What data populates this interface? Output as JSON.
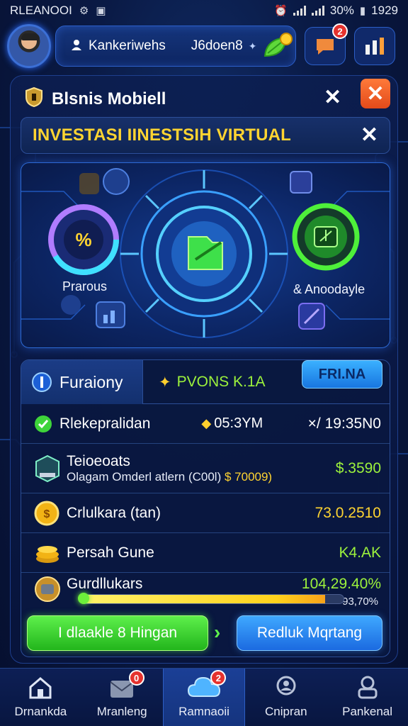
{
  "status_bar": {
    "carrier": "RLEANOOI",
    "battery": "30%",
    "time": "1929"
  },
  "header": {
    "username": "Kankeriwehs",
    "coins": "J6doen8",
    "notification_count": "2"
  },
  "panel": {
    "title": "Blsnis Mobiell",
    "banner": "INVESTASI IINESTSIH VIRTUAL",
    "hero": {
      "left_label": "Prarous",
      "right_label": "& Anoodayle"
    }
  },
  "stats": {
    "tabs": {
      "active": "Furaiony",
      "second": "PVONS K.1A",
      "button": "FRI.NA"
    },
    "rows": [
      {
        "label": "Rlekepralidan",
        "value_a": "05:3YM",
        "value_b": "×/ 19:35N0"
      },
      {
        "label": "Teioeoats",
        "sub": "Olagam Omderl atlern (C00l)",
        "sub_value": "$ 70009)",
        "value": "$.3590"
      },
      {
        "label": "Crlulkara (tan)",
        "value": "73.0.2510"
      },
      {
        "label": "Persah Gune",
        "value": "K4.AK"
      },
      {
        "label": "Gurdllukars",
        "value": "104,29.40%",
        "progress_text": "93,70%"
      }
    ],
    "progress": 0.93,
    "primary_button": "I dlaakle 8 Hingan",
    "secondary_button": "Redluk Mqrtang"
  },
  "nav": [
    {
      "label": "Drnankda",
      "icon": "home-icon"
    },
    {
      "label": "Mranleng",
      "icon": "mail-icon",
      "badge": "0"
    },
    {
      "label": "Ramnaoii",
      "icon": "cloud-icon",
      "badge": "2",
      "active": true
    },
    {
      "label": "Cnipran",
      "icon": "user-search-icon"
    },
    {
      "label": "Pankenal",
      "icon": "profile-icon"
    }
  ],
  "colors": {
    "accent_yellow": "#ffd431",
    "accent_green": "#9cf23c",
    "accent_blue": "#2c8cff",
    "badge_red": "#e5322e"
  }
}
